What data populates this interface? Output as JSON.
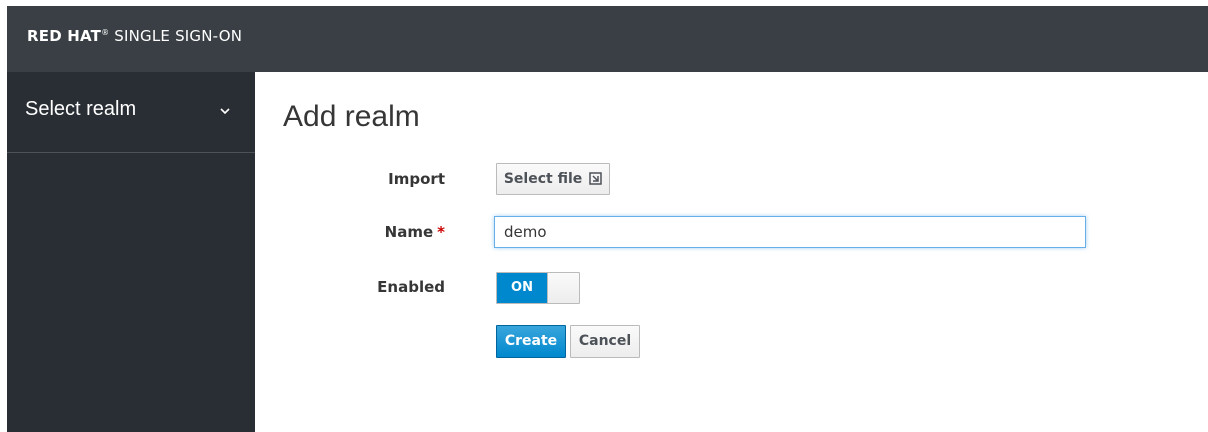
{
  "header": {
    "brand_bold": "RED HAT",
    "brand_regular": "SINGLE SIGN-ON"
  },
  "sidebar": {
    "realm_select_label": "Select realm",
    "chevron_icon": "chevron-down-icon"
  },
  "main": {
    "title": "Add realm",
    "form": {
      "import_label": "Import",
      "select_file_label": "Select file",
      "select_file_icon": "file-import-icon",
      "name_label": "Name",
      "name_required_marker": "*",
      "name_value": "demo",
      "enabled_label": "Enabled",
      "enabled_toggle_text": "ON",
      "enabled_state": true,
      "create_label": "Create",
      "cancel_label": "Cancel"
    }
  },
  "colors": {
    "header_bg": "#393f44",
    "sidebar_bg": "#292e34",
    "primary": "#0088ce",
    "required": "#cc0000",
    "focus_border": "#66afe9"
  }
}
